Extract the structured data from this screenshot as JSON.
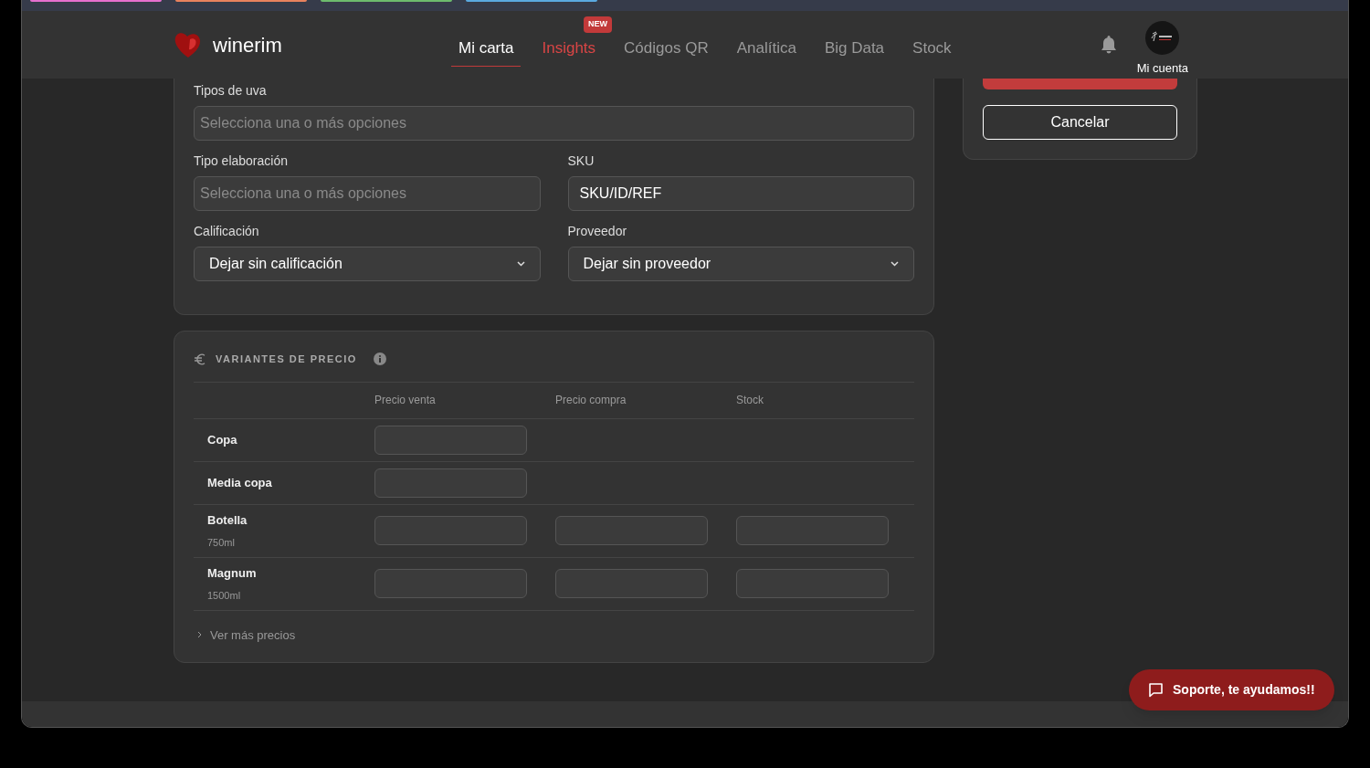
{
  "browser_tab_groups": [
    {
      "color": "#e56fcf"
    },
    {
      "color": "#e8825e"
    },
    {
      "color": "#6dbb6d"
    },
    {
      "color": "#5aa9e0"
    }
  ],
  "brand": {
    "name": "winerim"
  },
  "nav": [
    {
      "label": "Mi carta",
      "selected": true
    },
    {
      "label": "Insights",
      "selected": false,
      "highlighted": true,
      "badge": "NEW"
    },
    {
      "label": "Códigos QR",
      "selected": false
    },
    {
      "label": "Analítica",
      "selected": false
    },
    {
      "label": "Big Data",
      "selected": false
    },
    {
      "label": "Stock",
      "selected": false
    }
  ],
  "account": {
    "label": "Mi cuenta"
  },
  "form": {
    "fields": [
      {
        "kind": "multiselect",
        "label": "Tipos de uva",
        "placeholder": "Selecciona una o más opciones",
        "wide": true
      },
      {
        "kind": "multiselect",
        "label": "Tipo elaboración",
        "placeholder": "Selecciona una o más opciones"
      },
      {
        "kind": "text",
        "label": "SKU",
        "value": "SKU/ID/REF"
      },
      {
        "kind": "select",
        "label": "Calificación",
        "value": "Dejar sin calificación"
      },
      {
        "kind": "select",
        "label": "Proveedor",
        "value": "Dejar sin proveedor"
      }
    ]
  },
  "price_variants": {
    "title": "VARIANTES DE PRECIO",
    "columns": [
      "Precio venta",
      "Precio compra",
      "Stock"
    ],
    "rows": [
      {
        "name": "Copa",
        "inputs": [
          true,
          false,
          false
        ]
      },
      {
        "name": "Media copa",
        "inputs": [
          true,
          false,
          false
        ]
      },
      {
        "name": "Botella",
        "size": "750ml",
        "inputs": [
          true,
          true,
          true
        ]
      },
      {
        "name": "Magnum",
        "size": "1500ml",
        "inputs": [
          true,
          true,
          true
        ]
      }
    ],
    "more_link": "Ver más precios"
  },
  "actions": [
    {
      "kind": "primary"
    },
    {
      "kind": "secondary",
      "label": "Cancelar"
    }
  ],
  "support_button": {
    "label": "Soporte, te ayudamos!!"
  }
}
